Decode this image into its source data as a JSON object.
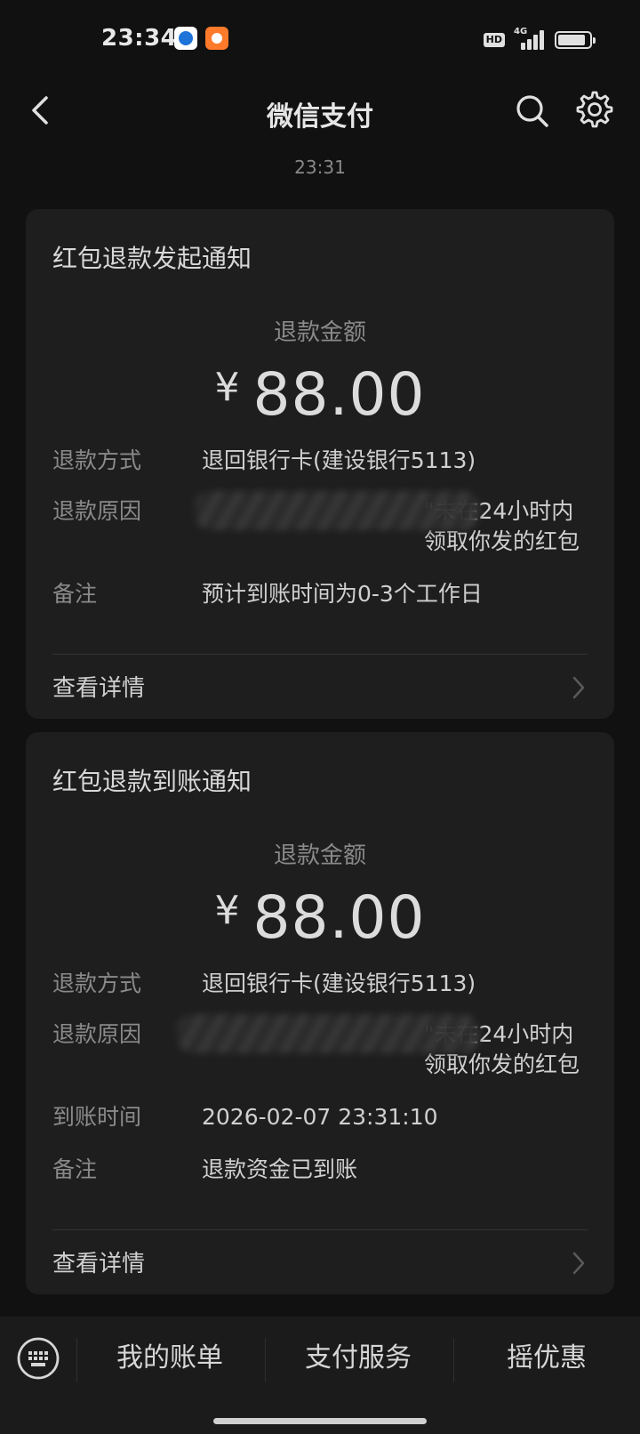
{
  "status_bar": {
    "time": "23:34",
    "network": "4G",
    "hd": "HD"
  },
  "nav": {
    "title": "微信支付"
  },
  "timestamp": "23:31",
  "cards": [
    {
      "title": "红包退款发起通知",
      "amount_label": "退款金额",
      "currency": "¥",
      "amount": "88.00",
      "rows": [
        {
          "key": "退款方式",
          "value": "退回银行卡(建设银行5113)"
        },
        {
          "key": "退款原因",
          "value": "\"未在24小时内领取你发的红包"
        },
        {
          "key": "备注",
          "value": "预计到账时间为0-3个工作日"
        }
      ],
      "detail_label": "查看详情"
    },
    {
      "title": "红包退款到账通知",
      "amount_label": "退款金额",
      "currency": "¥",
      "amount": "88.00",
      "rows": [
        {
          "key": "退款方式",
          "value": "退回银行卡(建设银行5113)"
        },
        {
          "key": "退款原因",
          "value": "\"未在24小时内领取你发的红包"
        },
        {
          "key": "到账时间",
          "value": "2026-02-07 23:31:10"
        },
        {
          "key": "备注",
          "value": "退款资金已到账"
        }
      ],
      "detail_label": "查看详情"
    }
  ],
  "bottom_bar": {
    "tabs": [
      "我的账单",
      "支付服务",
      "摇优惠"
    ]
  },
  "icons": {
    "back": "chevron-left-icon",
    "search": "search-icon",
    "settings": "gear-icon",
    "keyboard": "keyboard-icon",
    "chevron": "chevron-right-icon"
  },
  "colors": {
    "background": "#111111",
    "card": "#1e1e1e",
    "muted": "#8a8a8a"
  }
}
